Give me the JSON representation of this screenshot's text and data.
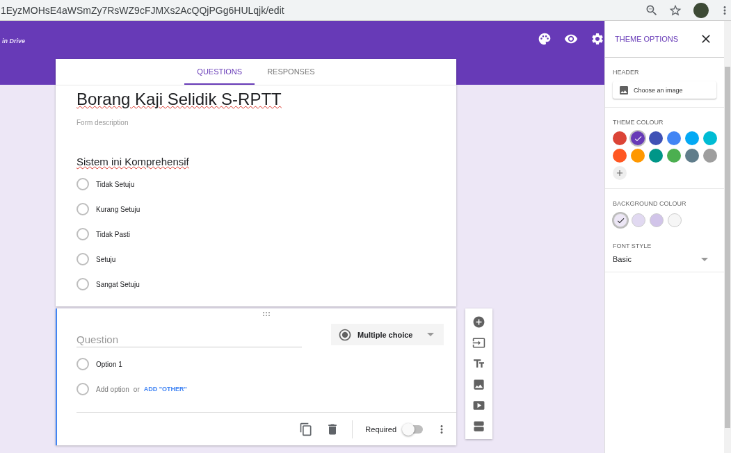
{
  "browser": {
    "url": "1EyzMOHsE4aWSmZy7RsWZ9cFJMXs2AcQQjPGg6HULqjk/edit"
  },
  "header": {
    "drive_text": "in Drive"
  },
  "tabs": [
    {
      "label": "QUESTIONS",
      "selected": true
    },
    {
      "label": "RESPONSES",
      "selected": false
    }
  ],
  "form": {
    "title": "Borang Kaji Selidik S-RPTT",
    "description_placeholder": "Form description",
    "question": "Sistem ini Komprehensif",
    "options": [
      {
        "label": "Tidak Setuju",
        "selected": false
      },
      {
        "label": "Kurang Setuju",
        "selected": false
      },
      {
        "label": "Tidak Pasti",
        "selected": false
      },
      {
        "label": "Setuju",
        "selected": false
      },
      {
        "label": "Sangat Setuju",
        "selected": false
      }
    ]
  },
  "editor": {
    "question_placeholder": "Question",
    "type": "Multiple choice",
    "options": [
      {
        "label": "Option 1",
        "selected": false
      }
    ],
    "add_option_selected": false,
    "add_option": "Add option",
    "or": "or",
    "add_other": "ADD \"OTHER\"",
    "required_label": "Required",
    "required": false
  },
  "theme_panel": {
    "title": "THEME OPTIONS",
    "header_label": "HEADER",
    "choose_image": "Choose an image",
    "theme_colour_label": "THEME COLOUR",
    "theme_colours": [
      {
        "color": "#db4437",
        "selected": false
      },
      {
        "color": "#673ab7",
        "selected": true
      },
      {
        "color": "#3f51b5",
        "selected": false
      },
      {
        "color": "#4285f4",
        "selected": false
      },
      {
        "color": "#03a9f4",
        "selected": false
      },
      {
        "color": "#00bcd4",
        "selected": false
      },
      {
        "color": "#ff5722",
        "selected": false
      },
      {
        "color": "#ff9800",
        "selected": false
      },
      {
        "color": "#009688",
        "selected": false
      },
      {
        "color": "#4caf50",
        "selected": false
      },
      {
        "color": "#607d8b",
        "selected": false
      },
      {
        "color": "#9e9e9e",
        "selected": false
      }
    ],
    "background_label": "BACKGROUND COLOUR",
    "background_colours": [
      {
        "color": "#ede7f6",
        "selected": true
      },
      {
        "color": "#e1d9f1",
        "selected": false
      },
      {
        "color": "#d1c4e9",
        "selected": false
      },
      {
        "color": "#f6f6f6",
        "selected": false
      }
    ],
    "font_style_label": "FONT STYLE",
    "font_style": "Basic"
  }
}
